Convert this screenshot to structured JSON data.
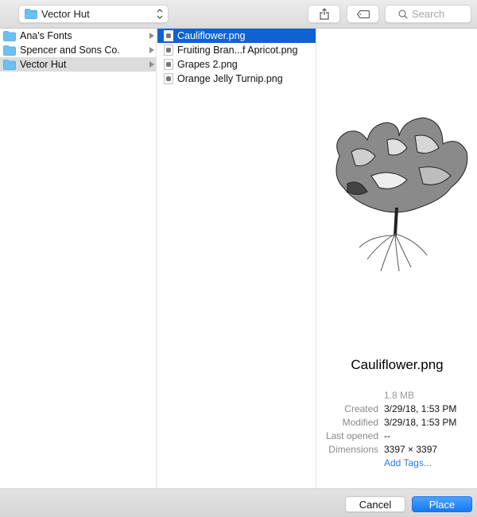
{
  "toolbar": {
    "location": "Vector Hut",
    "share_icon": "share-icon",
    "tag_icon": "tag-icon",
    "search_placeholder": "Search"
  },
  "sidebar": {
    "items": [
      {
        "label": "Ana's Fonts",
        "icon": "folder-icon",
        "selected": false
      },
      {
        "label": "Spencer and Sons Co.",
        "icon": "folder-icon",
        "selected": false
      },
      {
        "label": "Vector Hut",
        "icon": "folder-icon",
        "selected": true
      }
    ]
  },
  "files": {
    "items": [
      {
        "label": "Cauliflower.png",
        "icon": "image-file-icon",
        "selected": true
      },
      {
        "label": "Fruiting Bran...f Apricot.png",
        "icon": "image-file-icon",
        "selected": false
      },
      {
        "label": "Grapes 2.png",
        "icon": "image-file-icon",
        "selected": false
      },
      {
        "label": "Orange Jelly Turnip.png",
        "icon": "image-file-icon",
        "selected": false
      }
    ]
  },
  "preview": {
    "title": "Cauliflower.png",
    "size": "1.8 MB",
    "created_label": "Created",
    "created": "3/29/18, 1:53 PM",
    "modified_label": "Modified",
    "modified": "3/29/18, 1:53 PM",
    "last_opened_label": "Last opened",
    "last_opened": "--",
    "dimensions_label": "Dimensions",
    "dimensions": "3397 × 3397",
    "add_tags": "Add Tags..."
  },
  "footer": {
    "cancel_label": "Cancel",
    "place_label": "Place"
  },
  "colors": {
    "accent": "#0f63d0",
    "primary_button": "#1a7ff5",
    "link": "#2a7ae6",
    "folder": "#5fb8f0"
  }
}
